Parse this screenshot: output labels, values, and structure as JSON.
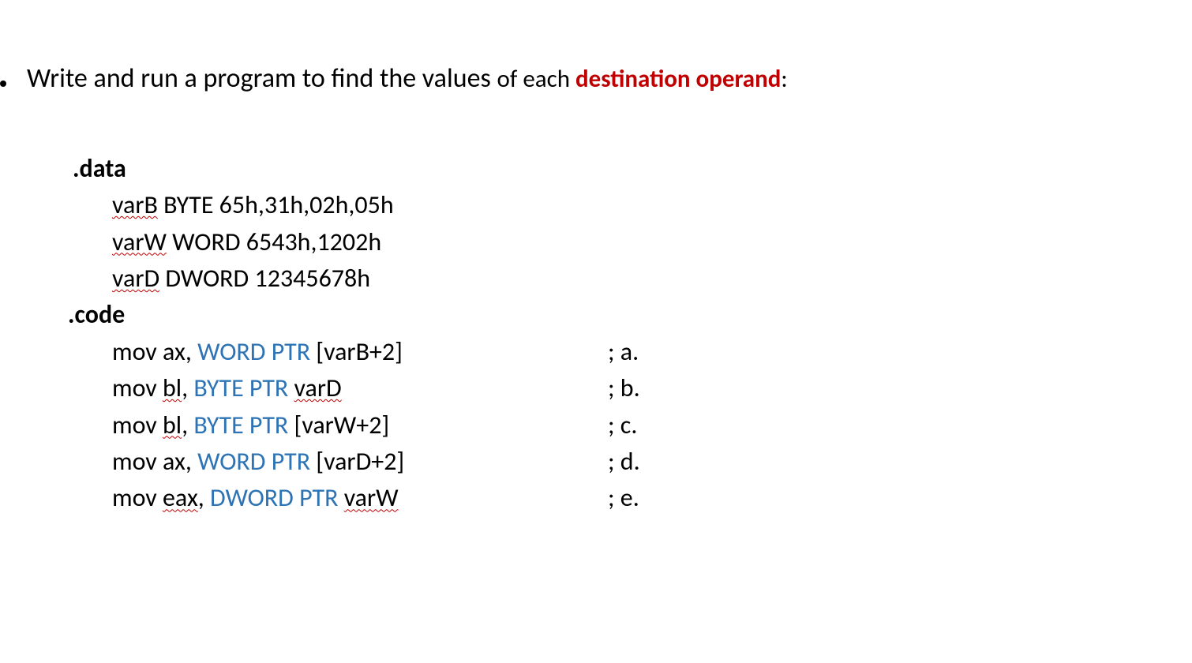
{
  "bullet": {
    "prefix": "Write and run a program to find the values ",
    "of_each": "of each ",
    "highlight": "destination operand",
    "colon": ":"
  },
  "code": {
    "data_label": ".data",
    "code_label": ".code",
    "decl": {
      "varB_name": "varB",
      "varB_rest": " BYTE  65h,31h,02h,05h",
      "varW_name": "varW",
      "varW_rest": " WORD  6543h,1202h",
      "varD_name": "varD",
      "varD_rest": " DWORD 12345678h"
    },
    "instr": [
      {
        "pre": "mov ax, ",
        "kw": "WORD PTR",
        "mid": " [varB+2]",
        "squig": "",
        "post": "",
        "comment": "; a."
      },
      {
        "pre": "mov ",
        "presq": "bl",
        "pre2": ", ",
        "kw": "BYTE PTR",
        "mid": "  ",
        "squig": "varD",
        "post": "",
        "comment": "; b."
      },
      {
        "pre": "mov ",
        "presq": "bl",
        "pre2": ", ",
        "kw": "BYTE PTR",
        "mid": " [varW+2]",
        "squig": "",
        "post": "",
        "comment": "; c."
      },
      {
        "pre": "mov ax, ",
        "kw": "WORD PTR",
        "mid": " [varD+2]",
        "squig": "",
        "post": "",
        "comment": "; d."
      },
      {
        "pre": "mov ",
        "presq": "eax",
        "pre2": ", ",
        "kw": "DWORD PTR",
        "mid": " ",
        "squig": "varW",
        "post": "",
        "comment": "; e."
      }
    ]
  }
}
